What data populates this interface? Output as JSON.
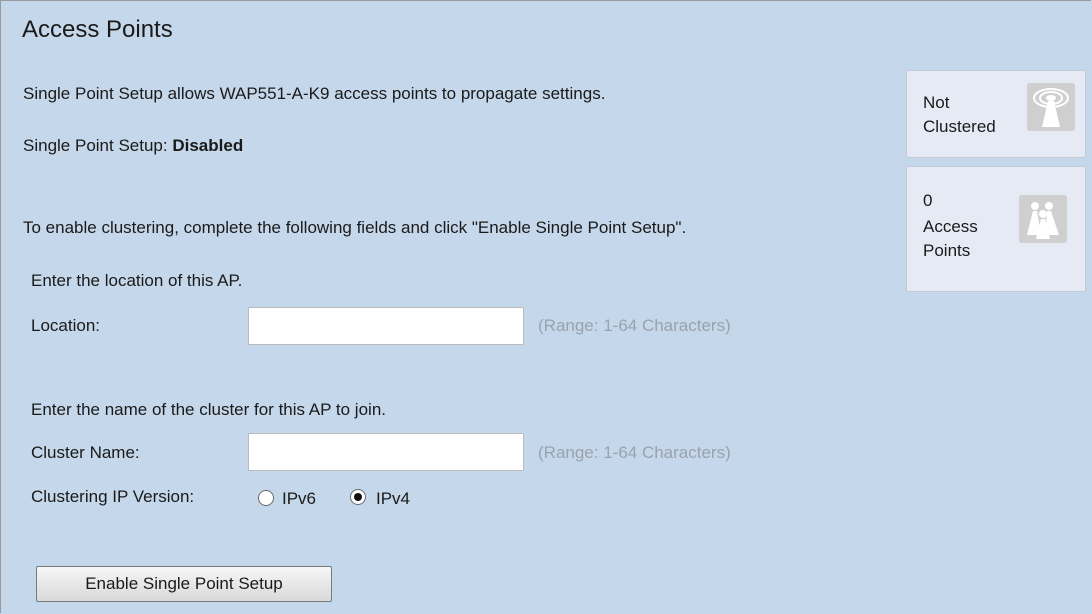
{
  "page": {
    "title": "Access Points",
    "intro": "Single Point Setup allows WAP551-A-K9 access points to propagate settings.",
    "status_label": "Single Point Setup:",
    "status_value": "Disabled",
    "instructions": "To enable clustering, complete the following fields and click \"Enable Single Point Setup\".",
    "location_prompt": "Enter the location of this AP.",
    "location_label": "Location:",
    "location_value": "",
    "location_hint": "(Range: 1-64 Characters)",
    "cluster_prompt": "Enter the name of the cluster for this AP to join.",
    "cluster_label": "Cluster Name:",
    "cluster_value": "",
    "cluster_hint": "(Range: 1-64 Characters)",
    "ip_version_label": "Clustering IP Version:",
    "ip_options": [
      {
        "label": "IPv6",
        "selected": false
      },
      {
        "label": "IPv4",
        "selected": true
      }
    ],
    "enable_button": "Enable Single Point Setup"
  },
  "cards": {
    "cluster_status": {
      "line1": "Not",
      "line2": "Clustered",
      "icon": "wireless-ap-icon"
    },
    "ap_count": {
      "count": "0",
      "line1": "Access",
      "line2": "Points",
      "icon": "access-points-group-icon"
    }
  },
  "colors": {
    "background": "#c5d7ea",
    "card_background": "#e5eaf5",
    "hint_text": "#9aa3ad",
    "icon_tile": "#cfcfcf"
  }
}
